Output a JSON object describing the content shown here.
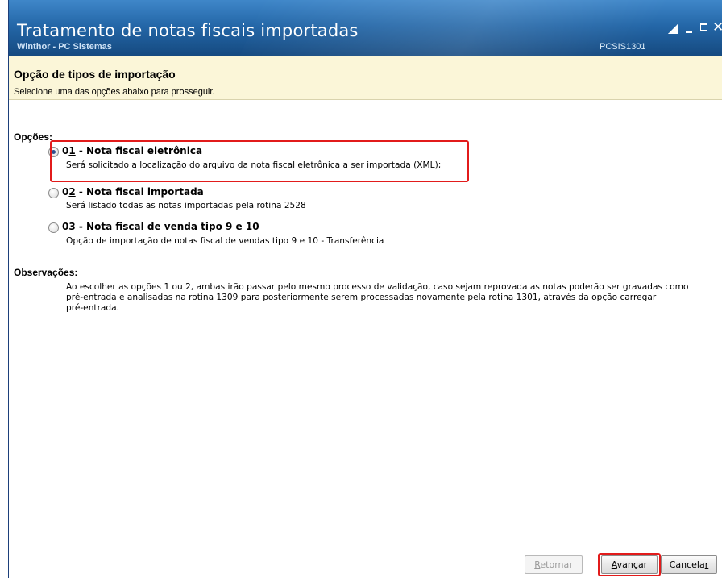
{
  "window": {
    "title": "Tratamento de notas fiscais importadas",
    "subtitle": "Winthor - PC Sistemas",
    "code": "PCSIS1301"
  },
  "header": {
    "title": "Opção de tipos de importação",
    "subtitle": "Selecione uma das opções abaixo para prosseguir."
  },
  "options": {
    "label": "Opções:",
    "items": [
      {
        "code_prefix": "0",
        "code_mnemonic": "1",
        "title": " - Nota fiscal eletrônica",
        "description": "Será solicitado a localização do arquivo da nota fiscal eletrônica a ser importada (XML);",
        "selected": true
      },
      {
        "code_prefix": "0",
        "code_mnemonic": "2",
        "title": " - Nota fiscal importada",
        "description": "Será listado todas as notas importadas pela rotina 2528",
        "selected": false
      },
      {
        "code_prefix": "0",
        "code_mnemonic": "3",
        "title": " - Nota fiscal de venda tipo 9 e 10",
        "description": "Opção de importação de notas fiscal de vendas tipo 9 e 10 - Transferência",
        "selected": false
      }
    ]
  },
  "observations": {
    "label": "Observações:",
    "lines": [
      "Ao escolher as opções 1 ou 2, ambas irão passar pelo mesmo processo de validação, caso sejam reprovada as notas poderão ser gravadas como",
      "pré-entrada e analisadas na rotina 1309 para posteriormente serem processadas novamente pela rotina 1301, através da opção carregar",
      "pré-entrada."
    ]
  },
  "buttons": {
    "back": {
      "mnemonic": "R",
      "rest": "etornar",
      "enabled": false
    },
    "next": {
      "mnemonic": "A",
      "rest": "vançar",
      "enabled": true
    },
    "cancel": {
      "prefix": "Cancela",
      "mnemonic": "r",
      "enabled": true
    }
  },
  "colors": {
    "titlebar": "#2467a8",
    "header_band": "#fbf6d8",
    "highlight": "#e21b1b"
  }
}
